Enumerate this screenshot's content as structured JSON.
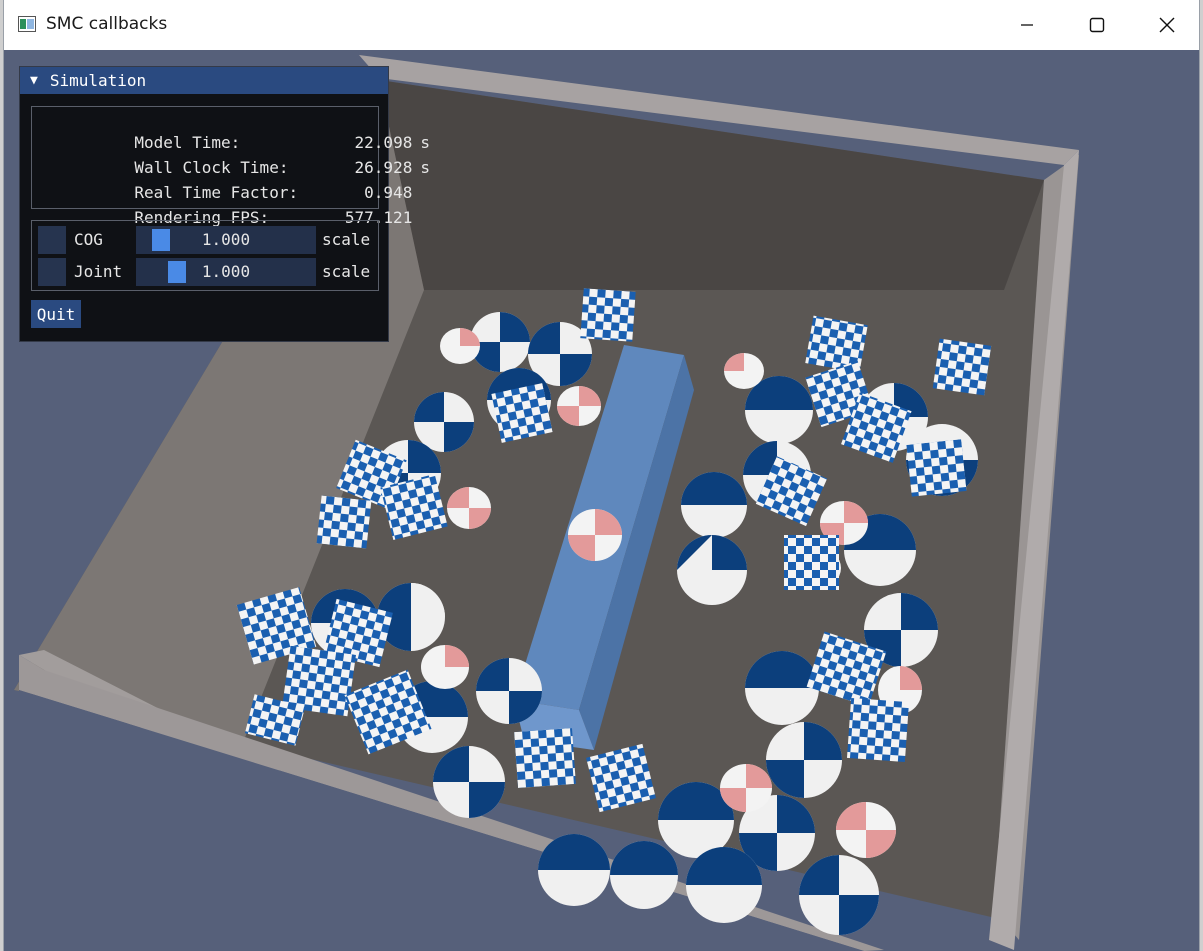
{
  "window": {
    "title": "SMC callbacks"
  },
  "panel": {
    "title": "Simulation",
    "stats": [
      {
        "label": "Model Time:",
        "value": "22.098",
        "unit": "s"
      },
      {
        "label": "Wall Clock Time:",
        "value": "26.928",
        "unit": "s"
      },
      {
        "label": "Real Time Factor:",
        "value": "0.948",
        "unit": ""
      },
      {
        "label": "Rendering FPS:",
        "value": "577.121",
        "unit": ""
      }
    ],
    "controls": [
      {
        "label": "COG",
        "value": "1.000",
        "suffix": "scale",
        "slider_fraction": 0.1
      },
      {
        "label": "Joint",
        "value": "1.000",
        "suffix": "scale",
        "slider_fraction": 0.2
      }
    ],
    "quit_label": "Quit"
  },
  "colors": {
    "panel_header": "#2a4a80",
    "slider_grab": "#4a8ae6",
    "viewport_background": "#56607a",
    "ball_blue": "#0c3f7c",
    "ball_red": "#e39a9a",
    "crate_wall": "#8e8a88",
    "bar": "#5f88bd"
  },
  "icons": [
    "app-icon",
    "minimize-icon",
    "maximize-icon",
    "close-icon",
    "collapse-triangle-icon"
  ]
}
